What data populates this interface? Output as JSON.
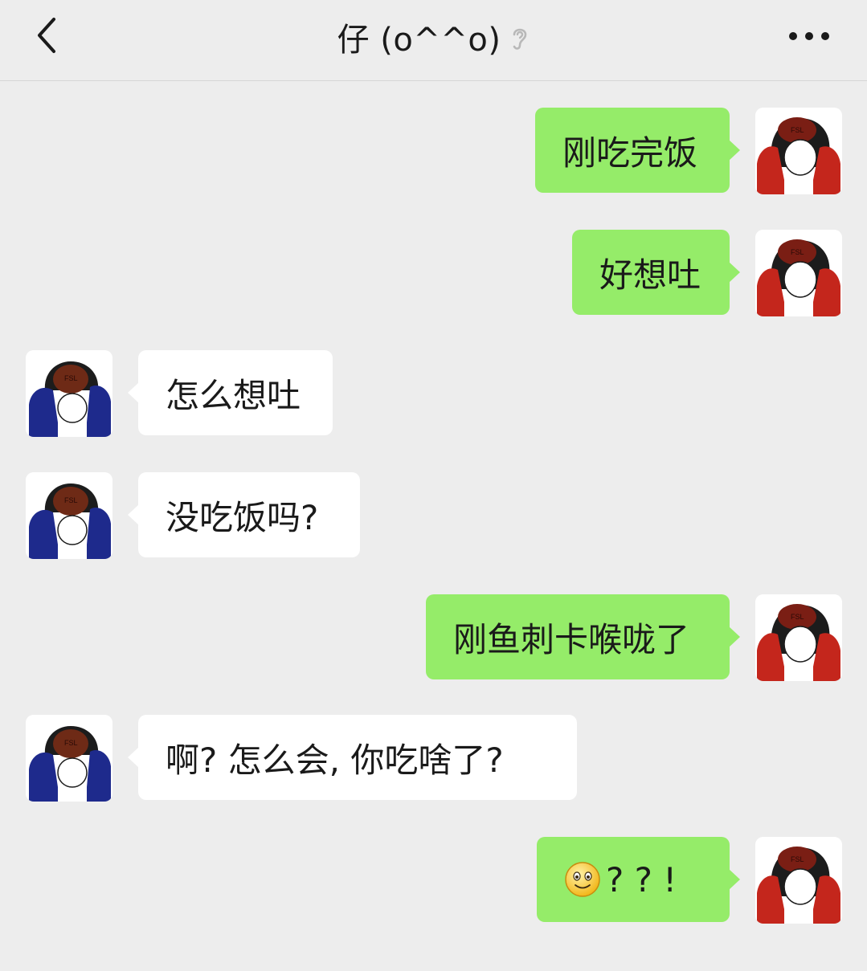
{
  "header": {
    "title": "仔 (o^^o)",
    "back_icon": "chevron-left-icon",
    "mute_icon": "ear-icon",
    "more_icon": "more-dots-icon"
  },
  "colors": {
    "background": "#EDEDED",
    "outgoing_bubble": "#95EC69",
    "incoming_bubble": "#FFFFFF",
    "self_avatar_accent": "#C4261C",
    "contact_avatar_accent": "#1E2A8C"
  },
  "messages": [
    {
      "side": "out",
      "text": "刚吃完饭"
    },
    {
      "side": "out",
      "text": "好想吐"
    },
    {
      "side": "in",
      "text": "怎么想吐"
    },
    {
      "side": "in",
      "text": "没吃饭吗?"
    },
    {
      "side": "out",
      "text": "刚鱼刺卡喉咙了"
    },
    {
      "side": "in",
      "text": "啊? 怎么会, 你吃啥了?"
    },
    {
      "side": "out",
      "emoji": "smile-emoji",
      "text": "? ? !"
    }
  ]
}
